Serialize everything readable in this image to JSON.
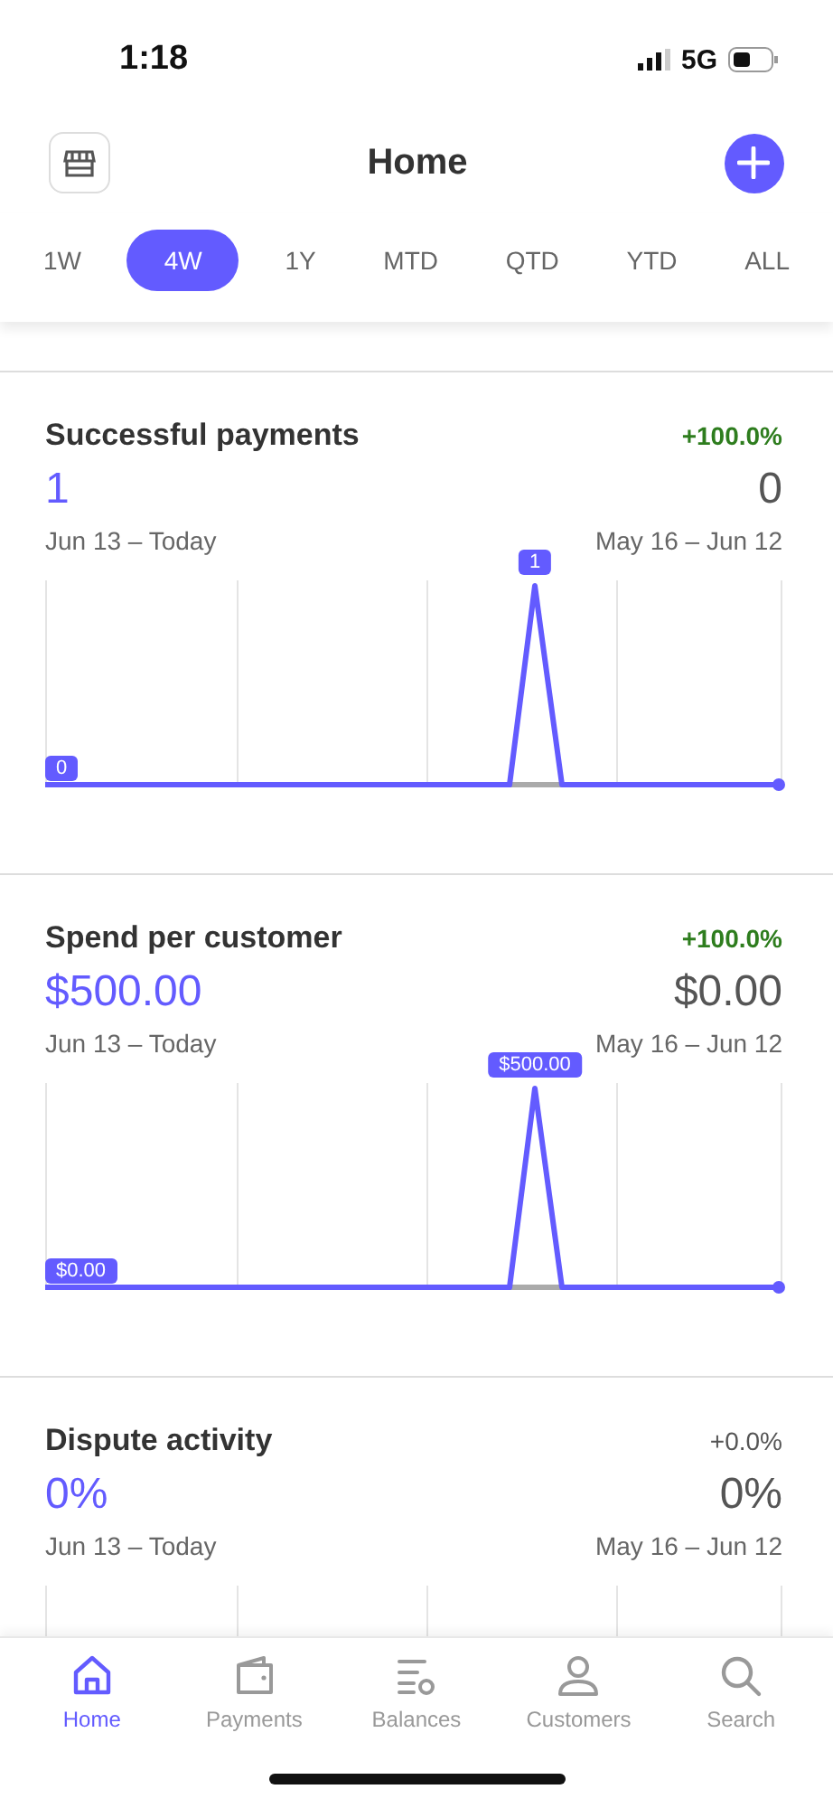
{
  "status_bar": {
    "time": "1:18",
    "network": "5G"
  },
  "header": {
    "title": "Home"
  },
  "periods": [
    {
      "label": "1W",
      "selected": false
    },
    {
      "label": "4W",
      "selected": true
    },
    {
      "label": "1Y",
      "selected": false
    },
    {
      "label": "MTD",
      "selected": false
    },
    {
      "label": "QTD",
      "selected": false
    },
    {
      "label": "YTD",
      "selected": false
    },
    {
      "label": "ALL",
      "selected": false
    }
  ],
  "cards": [
    {
      "title": "Successful payments",
      "change": "+100.0%",
      "kind": "up",
      "current": "1",
      "previous": "0",
      "current_range": "Jun 13 – Today",
      "previous_range": "May 16 – Jun 12",
      "chart": {
        "start_label": "0",
        "peak_label": "1"
      }
    },
    {
      "title": "Spend per customer",
      "change": "+100.0%",
      "kind": "up",
      "current": "$500.00",
      "previous": "$0.00",
      "current_range": "Jun 13 – Today",
      "previous_range": "May 16 – Jun 12",
      "chart": {
        "start_label": "$0.00",
        "peak_label": "$500.00"
      }
    },
    {
      "title": "Dispute activity",
      "change": "+0.0%",
      "kind": "flat",
      "current": "0%",
      "previous": "0%",
      "current_range": "Jun 13 – Today",
      "previous_range": "May 16 – Jun 12"
    }
  ],
  "tab_bar": [
    {
      "label": "Home",
      "selected": true,
      "kind": "home"
    },
    {
      "label": "Payments",
      "selected": false,
      "kind": "wallet"
    },
    {
      "label": "Balances",
      "selected": false,
      "kind": "balances"
    },
    {
      "label": "Customers",
      "selected": false,
      "kind": "person"
    },
    {
      "label": "Search",
      "selected": false,
      "kind": "search"
    }
  ]
}
